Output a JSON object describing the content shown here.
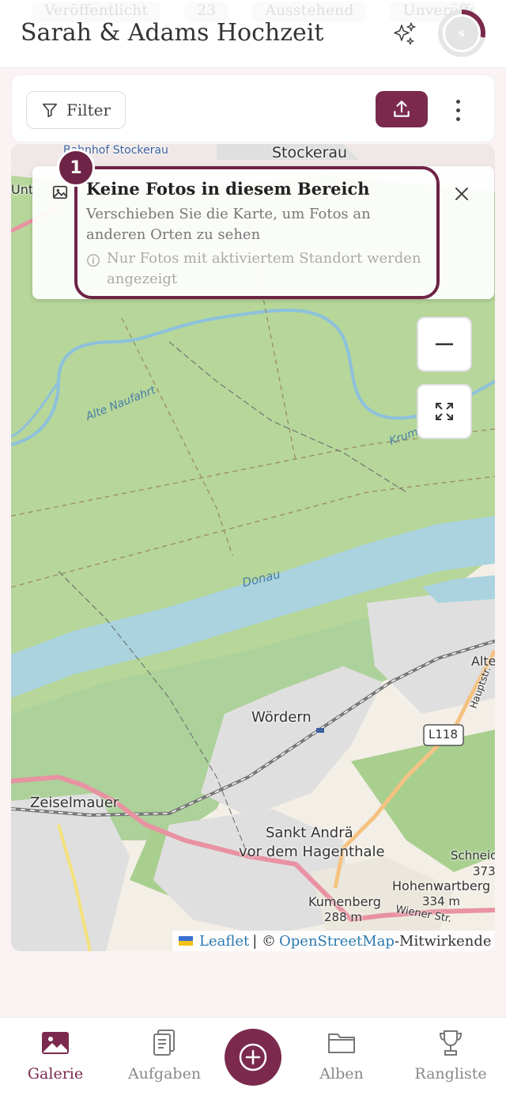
{
  "header": {
    "title": "Sarah & Adams Hochzeit",
    "ghost_stats": [
      "Veröffentlicht",
      "23",
      "Ausstehend",
      "Unveröffentlicht"
    ],
    "avatar_initial": "s",
    "progress_fraction": 0.28
  },
  "toolbar": {
    "filter_label": "Filter"
  },
  "map": {
    "labels": {
      "stockerau": "Stockerau",
      "stockerau_station": "Bahnhof Stockerau",
      "unt": "Unt",
      "alte_naufahrt": "Alte Naufahrt",
      "krum": "Krum",
      "donau": "Donau",
      "woerdern": "Wördern",
      "l118": "L118",
      "zeiselmauer": "Zeiselmauer",
      "sankt_andrae_1": "Sankt Andrä",
      "sankt_andrae_2": "vor dem Hagenthale",
      "schneid": "Schneid",
      "num373": "373",
      "hohenwartberg": "Hohenwartberg",
      "hw_height": "334 m",
      "kumenberg": "Kumenberg",
      "k_height": "288 m",
      "wiener_str": "Wiener Str.",
      "alte": "Alte",
      "hauptstr": "Hauptstr."
    },
    "notice": {
      "title": "Keine Fotos in diesem Bereich",
      "subtitle": "Verschieben Sie die Karte, um Fotos an anderen Orten zu sehen",
      "hint": "Nur Fotos mit aktiviertem Standort werden angezeigt",
      "step": "1"
    },
    "attribution": {
      "leaflet": "Leaflet",
      "separator": "| ©",
      "osm": "OpenStreetMap",
      "suffix": "-Mitwirkende"
    }
  },
  "nav": {
    "items": [
      {
        "label": "Galerie",
        "icon": "gallery-icon",
        "active": true
      },
      {
        "label": "Aufgaben",
        "icon": "tasks-icon",
        "active": false
      },
      {
        "label": "Alben",
        "icon": "folder-icon",
        "active": false
      },
      {
        "label": "Rangliste",
        "icon": "trophy-icon",
        "active": false
      }
    ],
    "center_icon": "add-icon"
  },
  "colors": {
    "accent": "#7b2a4e",
    "forest": "#a9cf8e",
    "river": "#aad3df",
    "residential": "#e0dfdf"
  }
}
